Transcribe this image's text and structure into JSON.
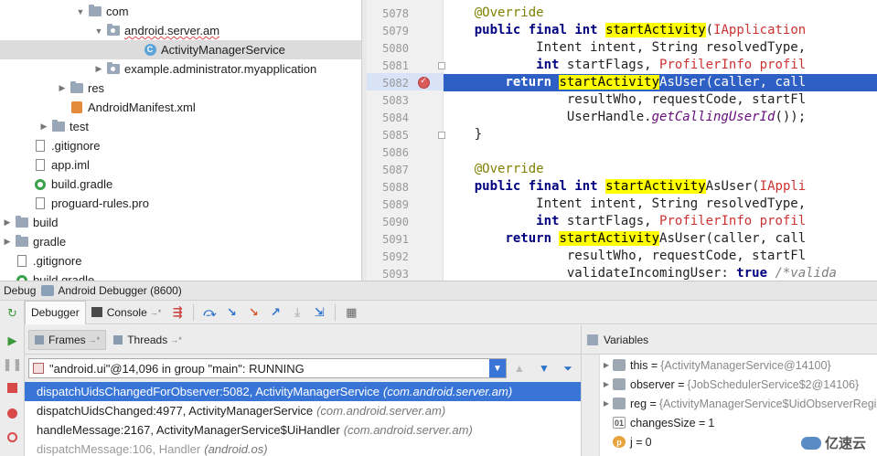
{
  "project_tree": [
    {
      "label": "com",
      "depth": 5,
      "arrow": "▼",
      "icon": "folder-icon",
      "selected": false
    },
    {
      "label": "android.server.am",
      "depth": 6,
      "arrow": "▼",
      "icon": "package-icon",
      "selected": false,
      "squiggle": true
    },
    {
      "label": "ActivityManagerService",
      "depth": 8,
      "arrow": "",
      "icon": "class-icon",
      "selected": true
    },
    {
      "label": "example.administrator.myapplication",
      "depth": 6,
      "arrow": "▶",
      "icon": "package-icon",
      "selected": false
    },
    {
      "label": "res",
      "depth": 4,
      "arrow": "▶",
      "icon": "folder-icon",
      "selected": false
    },
    {
      "label": "AndroidManifest.xml",
      "depth": 4,
      "arrow": "",
      "icon": "xml-icon",
      "selected": false
    },
    {
      "label": "test",
      "depth": 3,
      "arrow": "▶",
      "icon": "folder-icon",
      "selected": false
    },
    {
      "label": ".gitignore",
      "depth": 2,
      "arrow": "",
      "icon": "file-icon",
      "selected": false
    },
    {
      "label": "app.iml",
      "depth": 2,
      "arrow": "",
      "icon": "file-icon",
      "selected": false
    },
    {
      "label": "build.gradle",
      "depth": 2,
      "arrow": "",
      "icon": "gradle-icon",
      "selected": false
    },
    {
      "label": "proguard-rules.pro",
      "depth": 2,
      "arrow": "",
      "icon": "file-icon",
      "selected": false
    },
    {
      "label": "build",
      "depth": 1,
      "arrow": "▶",
      "icon": "folder-icon",
      "selected": false
    },
    {
      "label": "gradle",
      "depth": 1,
      "arrow": "▶",
      "icon": "folder-icon",
      "selected": false
    },
    {
      "label": ".gitignore",
      "depth": 1,
      "arrow": "",
      "icon": "file-icon",
      "selected": false
    },
    {
      "label": "build.gradle",
      "depth": 1,
      "arrow": "",
      "icon": "gradle-icon",
      "selected": false
    }
  ],
  "editor": {
    "line_numbers": [
      "5078",
      "5079",
      "5080",
      "5081",
      "5082",
      "5083",
      "5084",
      "5085",
      "5086",
      "5087",
      "5088",
      "5089",
      "5090",
      "5091",
      "5092",
      "5093"
    ],
    "lines": [
      "    @Override",
      "    public final int startActivity(IApplication",
      "            Intent intent, String resolvedType,",
      "            int startFlags, ProfilerInfo profil",
      "        return startActivityAsUser(caller, call",
      "                resultWho, requestCode, startFl",
      "                UserHandle.getCallingUserId());",
      "    }",
      "",
      "    @Override",
      "    public final int startActivityAsUser(IAppli",
      "            Intent intent, String resolvedType,",
      "            int startFlags, ProfilerInfo profil",
      "        return startActivityAsUser(caller, call",
      "                resultWho, requestCode, startFl",
      "                validateIncomingUser: true /*valida"
    ],
    "exec_line": "5082"
  },
  "debug": {
    "title": "Debug",
    "config_name": "Android Debugger (8600)",
    "tab_debugger": "Debugger",
    "tab_console": "Console",
    "tab_console_suffix": "→*",
    "frames_tab": "Frames",
    "frames_suffix": "→*",
    "threads_tab": "Threads",
    "threads_suffix": "→*",
    "thread_selected": "\"android.ui\"@14,096 in group \"main\": RUNNING",
    "frames": [
      {
        "method": "dispatchUidsChangedForObserver:5082, ActivityManagerService",
        "loc": "(com.android.server.am)",
        "state": "selected"
      },
      {
        "method": "dispatchUidsChanged:4977, ActivityManagerService",
        "loc": "(com.android.server.am)",
        "state": "normal"
      },
      {
        "method": "handleMessage:2167, ActivityManagerService$UiHandler",
        "loc": "(com.android.server.am)",
        "state": "normal"
      },
      {
        "method": "dispatchMessage:106, Handler",
        "loc": "(android.os)",
        "state": "grey"
      }
    ],
    "variables_title": "Variables",
    "variables": [
      {
        "name": "this",
        "value": "{ActivityManagerService@14100}",
        "icon": "field",
        "expandable": true
      },
      {
        "name": "observer",
        "value": "{JobSchedulerService$2@14106}",
        "icon": "field",
        "expandable": true
      },
      {
        "name": "reg",
        "value": "{ActivityManagerService$UidObserverRegi",
        "icon": "field",
        "expandable": true
      },
      {
        "name": "changesSize",
        "value": "1",
        "icon": "primitive",
        "expandable": false
      },
      {
        "name": "j",
        "value": "0",
        "icon": "param",
        "expandable": false
      }
    ],
    "watermark": "亿速云"
  }
}
